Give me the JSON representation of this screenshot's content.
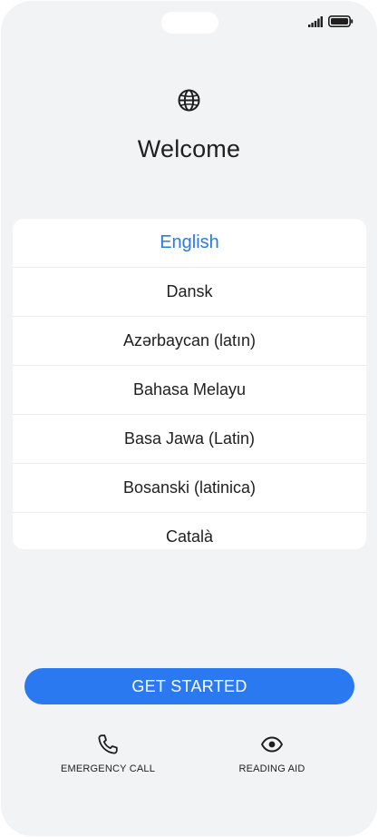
{
  "status_bar": {
    "signal_icon": "cellular-signal-icon",
    "battery_icon": "battery-icon"
  },
  "header": {
    "icon": "globe-icon",
    "title": "Welcome"
  },
  "languages": {
    "selected": "English",
    "items": [
      "English",
      "Dansk",
      "Azərbaycan (latın)",
      "Bahasa Melayu",
      "Basa Jawa (Latin)",
      "Bosanski (latinica)",
      "Català"
    ]
  },
  "actions": {
    "get_started": "GET STARTED",
    "emergency_call": "EMERGENCY CALL",
    "emergency_icon": "phone-icon",
    "reading_aid": "READING AID",
    "reading_icon": "eye-icon"
  },
  "colors": {
    "accent": "#2a79f0",
    "selected_text": "#2979e8",
    "background": "#f1f3f5"
  }
}
